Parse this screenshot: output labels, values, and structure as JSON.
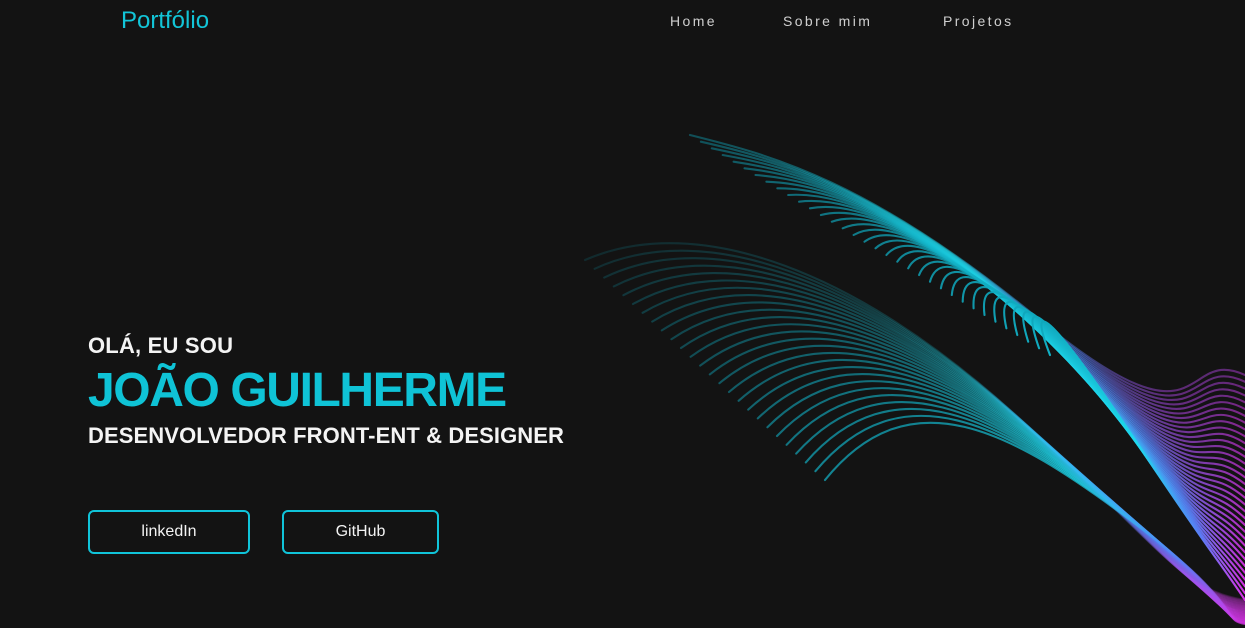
{
  "header": {
    "brand": "Portfólio",
    "nav": [
      {
        "label": "Home"
      },
      {
        "label": "Sobre mim"
      },
      {
        "label": "Projetos"
      }
    ]
  },
  "hero": {
    "greeting": "OLÁ, EU SOU",
    "name": "JOÃO GUILHERME",
    "role": "DESENVOLVEDOR FRONT-ENT & DESIGNER"
  },
  "actions": {
    "linkedin_label": "linkedIn",
    "github_label": "GitHub"
  },
  "colors": {
    "background": "#131313",
    "accent": "#12c5d8",
    "text": "#f4f4f4",
    "nav_text": "#cfcfcf",
    "wave_cyan": "#18d7ea",
    "wave_magenta": "#d82ee8"
  },
  "decorations": {
    "hero_art": "neon-wave-icon"
  }
}
